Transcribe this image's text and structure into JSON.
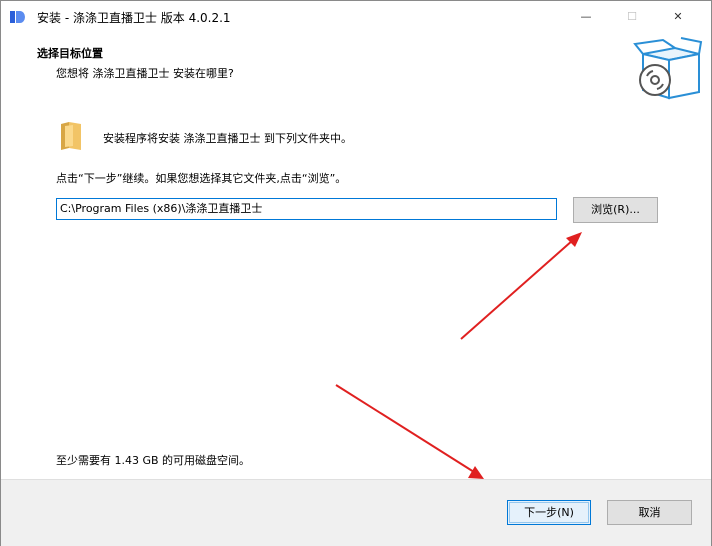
{
  "window": {
    "title": "安装 - 涤涤卫直播卫士 版本 4.0.2.1",
    "controls": {
      "minimize": "—",
      "maximize": "☐",
      "close": "✕"
    }
  },
  "header": {
    "title": "选择目标位置",
    "subtitle": "您想将 涤涤卫直播卫士 安装在哪里?"
  },
  "content": {
    "folder_text": "安装程序将安装 涤涤卫直播卫士 到下列文件夹中。",
    "instruction": "点击“下一步”继续。如果您想选择其它文件夹,点击“浏览”。",
    "install_path": "C:\\Program Files (x86)\\涤涤卫直播卫士",
    "browse_label": "浏览(R)...",
    "disk_space": "至少需要有 1.43 GB 的可用磁盘空间。"
  },
  "footer": {
    "next_label": "下一步(N)",
    "cancel_label": "取消"
  },
  "icons": {
    "app": "app-logo-icon",
    "header": "software-box-icon",
    "folder": "folder-icon"
  },
  "colors": {
    "annotation_arrow": "#e02020",
    "focus_border": "#0078d7",
    "box_blue": "#2a8fd6"
  }
}
